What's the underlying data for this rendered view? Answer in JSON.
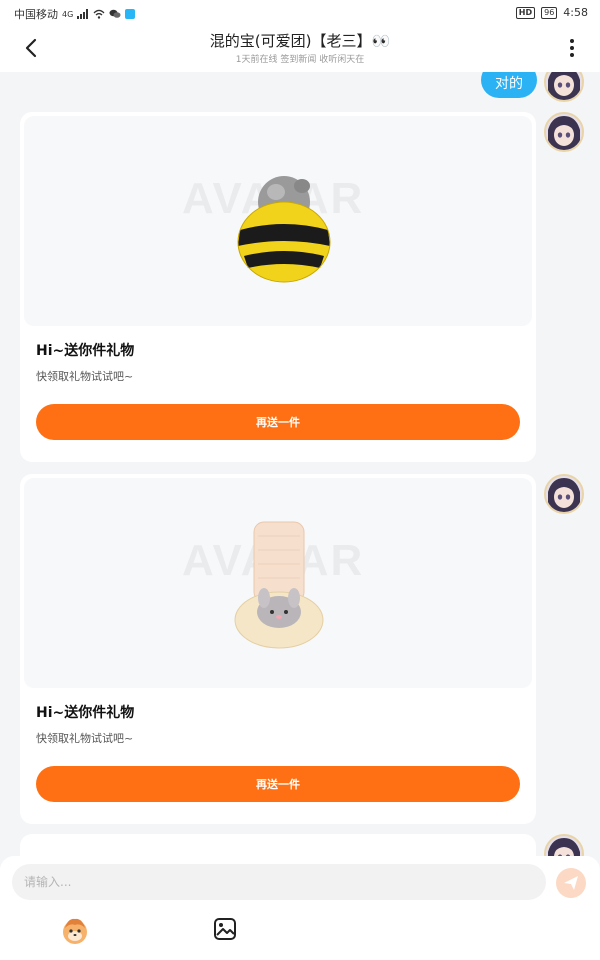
{
  "status_bar": {
    "carrier": "中国移动",
    "signal": "4G",
    "battery": "96",
    "time": "4:58",
    "hd_badge": "HD"
  },
  "header": {
    "title": "混的宝(可爱团)【老三】👀",
    "subtitle": "1天前在线 签到新闻 收听闲天在"
  },
  "messages": {
    "reply_bubble": "对的",
    "gift_cards": [
      {
        "title": "Hi~送你件礼物",
        "desc": "快领取礼物试试吧~",
        "button": "再送一件",
        "image": "bee-plush-gift"
      },
      {
        "title": "Hi~送你件礼物",
        "desc": "快领取礼物试试吧~",
        "button": "再送一件",
        "image": "bunny-sock-gift"
      }
    ],
    "watermark": "AVATAR"
  },
  "input_bar": {
    "placeholder": "请输入..."
  },
  "colors": {
    "accent_orange": "#fe7013",
    "bubble_blue": "#2ab2f5",
    "background": "#f4f5f7"
  },
  "icons": [
    "back-arrow-icon",
    "more-vertical-icon",
    "send-icon",
    "emoji-icon",
    "image-icon"
  ]
}
